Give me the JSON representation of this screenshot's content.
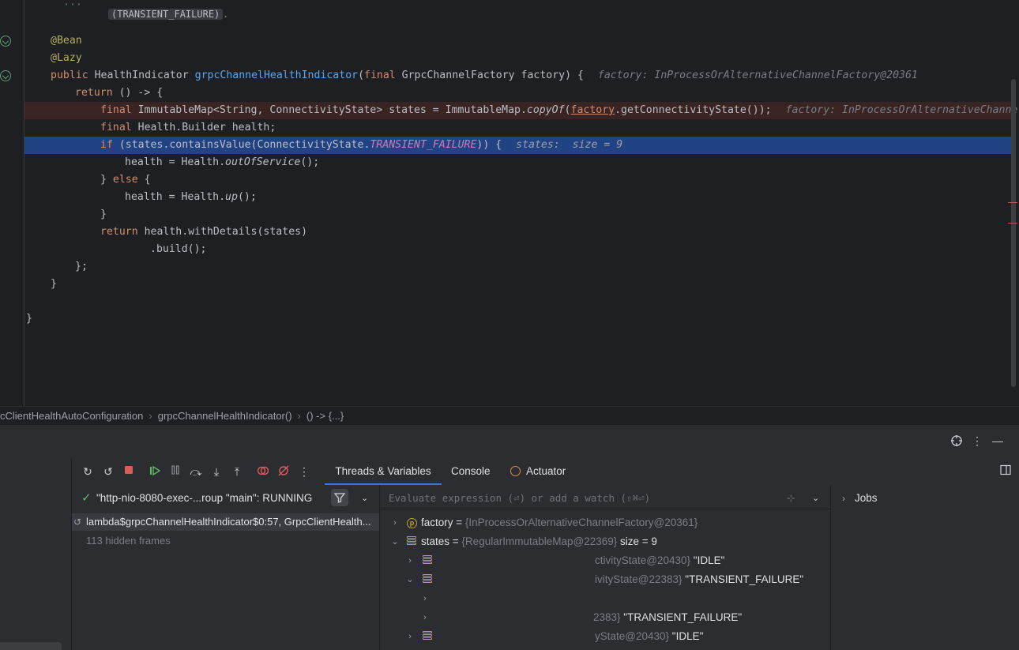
{
  "editor": {
    "doc_fragment": "(TRANSIENT_FAILURE)",
    "lines": {
      "bean": "@Bean",
      "lazy": "@Lazy",
      "sig_public": "public",
      "sig_type": "HealthIndicator",
      "sig_name": "grpcChannelHealthIndicator",
      "sig_rest_a": "(",
      "sig_final": "final",
      "sig_rest_b": " GrpcChannelFactory factory) {",
      "sig_hint": "factory: InProcessOrAlternativeChannelFactory@20361",
      "ret_kw": "return",
      "ret_rest": " () -> {",
      "states_final": "final",
      "states_a": " ImmutableMap<String, ConnectivityState> states = ImmutableMap.",
      "states_copy": "copyOf",
      "states_b": "(",
      "states_factory": "factory",
      "states_c": ".getConnectivityState());",
      "states_hint": "factory: InProcessOrAlternativeChannelF",
      "builder_final": "final",
      "builder_rest": " Health.Builder health;",
      "if_kw": "if",
      "if_a": " (states.containsValue(ConnectivityState.",
      "if_const": "TRANSIENT_FAILURE",
      "if_b": ")) {",
      "if_hint": "states:  size = 9",
      "oos_a": "health = Health.",
      "oos_m": "outOfService",
      "oos_b": "();",
      "else_a": "} ",
      "else_kw": "else",
      "else_b": " {",
      "up_a": "health = Health.",
      "up_m": "up",
      "up_b": "();",
      "close1": "}",
      "ret2_kw": "return",
      "ret2_rest": " health.withDetails(states)",
      "build": ".build();",
      "close2": "};",
      "close3": "}",
      "close4": "}"
    }
  },
  "breadcrumb": {
    "items": [
      "cClientHealthAutoConfiguration",
      "grpcChannelHealthIndicator()",
      "() -> {...}"
    ],
    "separator": "›"
  },
  "debug": {
    "header_icons": [
      "crosshair-icon",
      "more-icon",
      "minimize-icon"
    ],
    "toolbar_icons": [
      "rerun-icon",
      "restart-icon",
      "stop-icon",
      "resume-icon",
      "pause-icon",
      "step-over-icon",
      "step-into-icon",
      "step-out-icon",
      "view-breakpoints-icon",
      "mute-breakpoints-icon",
      "more-icon"
    ],
    "tabs": [
      "Threads & Variables",
      "Console",
      "Actuator"
    ],
    "thread": {
      "label": "\"http-nio-8080-exec-...roup \"main\": RUNNING"
    },
    "frames": [
      "lambda$grpcChannelHealthIndicator$0:57, GrpcClientHealth...",
      "113 hidden frames"
    ],
    "eval_placeholder": "Evaluate expression (⏎) or add a watch (⇧⌘⏎)",
    "variables": {
      "factory_name": "factory",
      "factory_eq": " = ",
      "factory_val": "{InProcessOrAlternativeChannelFactory@20361}",
      "states_name": "states",
      "states_eq": " = ",
      "states_val": "{RegularImmutableMap@22369}",
      "states_size": " size = 9",
      "row1_a": "ctivityState@20430}",
      "row1_b": " \"IDLE\"",
      "row2_a": "ivityState@22383}",
      "row2_b": " \"TRANSIENT_FAILURE\"",
      "row4_a": "2383}",
      "row4_b": " \"TRANSIENT_FAILURE\"",
      "row5_a": "yState@20430}",
      "row5_b": " \"IDLE\""
    },
    "jobs_label": "Jobs"
  },
  "colors": {
    "background": "#1e1f22",
    "panel": "#2b2d30",
    "execution_line": "#214283",
    "breakpoint_line": "#3a2323",
    "accent": "#3574f0"
  }
}
